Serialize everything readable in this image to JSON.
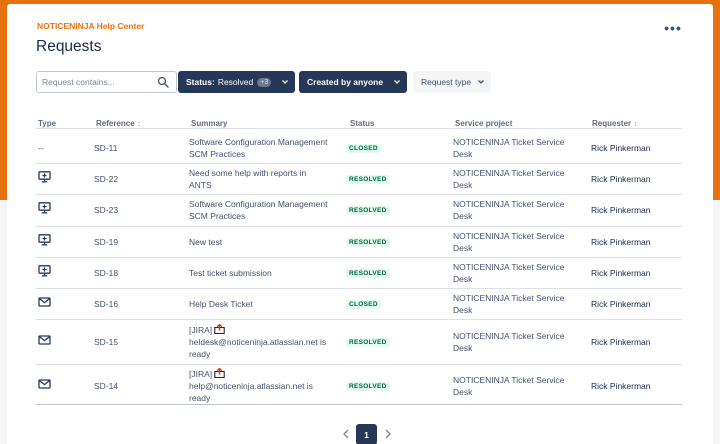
{
  "header": {
    "help_center": "NOTICENINJA Help Center",
    "title": "Requests",
    "more_label": "•••"
  },
  "filters": {
    "search_placeholder": "Request contains...",
    "status_label": "Status:",
    "status_value": "Resolved",
    "status_extra": "+3",
    "created_label": "Created by anyone",
    "type_label": "Request type"
  },
  "columns": {
    "type": "Type",
    "reference": "Reference",
    "summary": "Summary",
    "status": "Status",
    "project": "Service project",
    "requester": "Requester",
    "sort_indicator": "↕"
  },
  "rows": [
    {
      "type_icon": "none",
      "type_text": "--",
      "ref": "SD-11",
      "summary": "Software Configuration Management SCM Practices",
      "summary_ext": "",
      "status": "CLOSED",
      "project": "NOTICENINJA Ticket Service Desk",
      "requester": "Rick Pinkerman"
    },
    {
      "type_icon": "monitor-icon",
      "type_text": "",
      "ref": "SD-22",
      "summary": "Need some help with reports in ANTS",
      "summary_ext": "",
      "status": "RESOLVED",
      "project": "NOTICENINJA Ticket Service Desk",
      "requester": "Rick Pinkerman"
    },
    {
      "type_icon": "monitor-icon",
      "type_text": "",
      "ref": "SD-23",
      "summary": "Software Configuration Management SCM Practices",
      "summary_ext": "",
      "status": "RESOLVED",
      "project": "NOTICENINJA Ticket Service Desk",
      "requester": "Rick Pinkerman"
    },
    {
      "type_icon": "monitor-icon",
      "type_text": "",
      "ref": "SD-19",
      "summary": "New test",
      "summary_ext": "",
      "status": "RESOLVED",
      "project": "NOTICENINJA Ticket Service Desk",
      "requester": "Rick Pinkerman"
    },
    {
      "type_icon": "monitor-icon",
      "type_text": "",
      "ref": "SD-18",
      "summary": "Test ticket submission",
      "summary_ext": "",
      "status": "RESOLVED",
      "project": "NOTICENINJA Ticket Service Desk",
      "requester": "Rick Pinkerman"
    },
    {
      "type_icon": "email-icon",
      "type_text": "",
      "ref": "SD-16",
      "summary": "Help Desk Ticket",
      "summary_ext": "",
      "status": "CLOSED",
      "project": "NOTICENINJA Ticket Service Desk",
      "requester": "Rick Pinkerman"
    },
    {
      "type_icon": "email-icon",
      "type_text": "",
      "ref": "SD-15",
      "summary": "[JIRA]",
      "summary_ext": "heldesk@noticeninja.atlassian.net is ready",
      "status": "RESOLVED",
      "project": "NOTICENINJA Ticket Service Desk",
      "requester": "Rick Pinkerman"
    },
    {
      "type_icon": "email-icon",
      "type_text": "",
      "ref": "SD-14",
      "summary": "[JIRA]",
      "summary_ext": "help@noticeninja.atlassian.net is ready",
      "status": "RESOLVED",
      "project": "NOTICENINJA Ticket Service Desk",
      "requester": "Rick Pinkerman"
    }
  ],
  "pagination": {
    "current": "1"
  },
  "colors": {
    "brand": "#e6720f",
    "navy": "#253858",
    "status_green_bg": "#e3fcef",
    "status_green_text": "#006644"
  }
}
